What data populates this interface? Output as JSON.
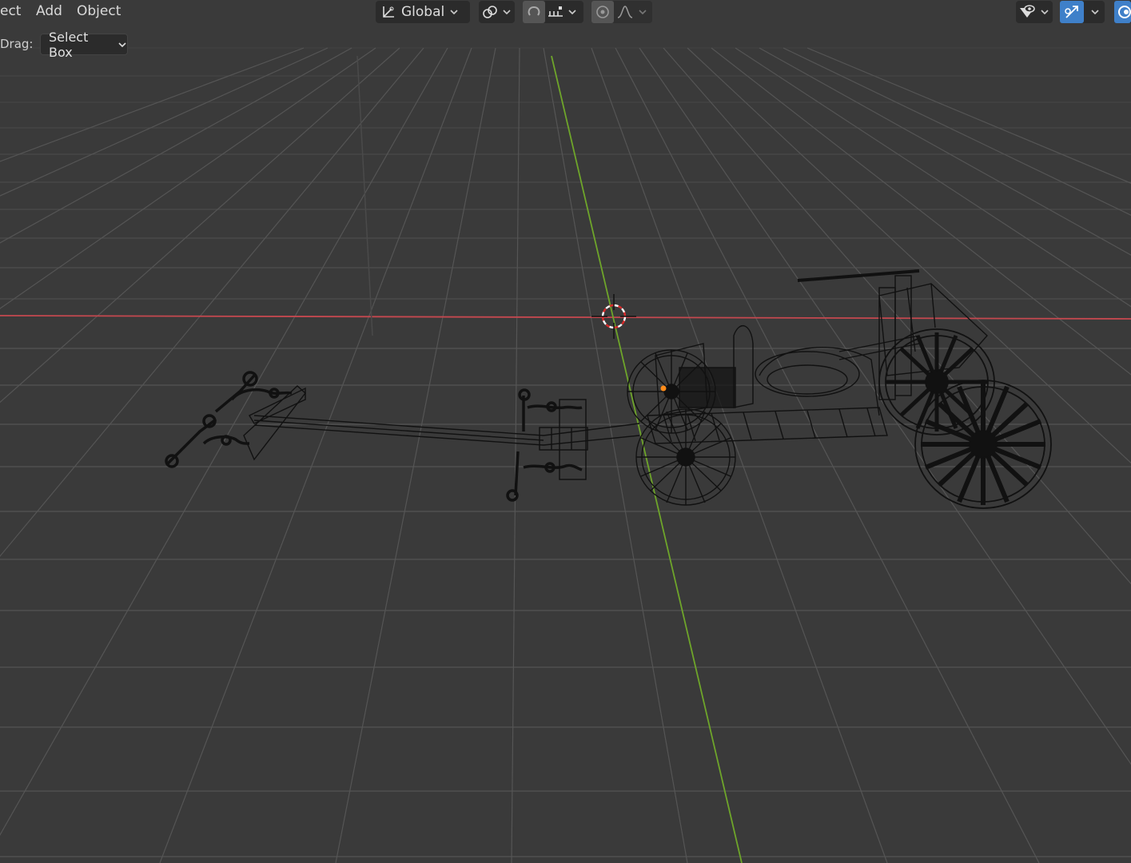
{
  "header": {
    "menu": [
      {
        "label": "ect"
      },
      {
        "label": "Add"
      },
      {
        "label": "Object"
      }
    ],
    "transform_orientation": "Global",
    "icons": {
      "orientation": "axis-gizmo-icon",
      "pivot": "pivot-link-icon",
      "snap": "magnet-snap-icon",
      "snap_target": "snap-increment-icon",
      "proportional": "proportional-edit-icon",
      "falloff": "falloff-curve-icon",
      "visibility": "eye-visibility-icon",
      "gizmo": "gizmo-toggle-icon",
      "overlay": "overlay-icon"
    }
  },
  "tool_settings": {
    "drag_label": "Drag:",
    "drag_value": "Select Box"
  },
  "colors": {
    "background": "#3a3a3a",
    "grid": "#555555",
    "x_axis": "#c5484f",
    "y_axis": "#6ea52a",
    "mesh": "#111111",
    "accent_blue": "#3f80c9",
    "origin_dot": "#ff8c1a"
  }
}
